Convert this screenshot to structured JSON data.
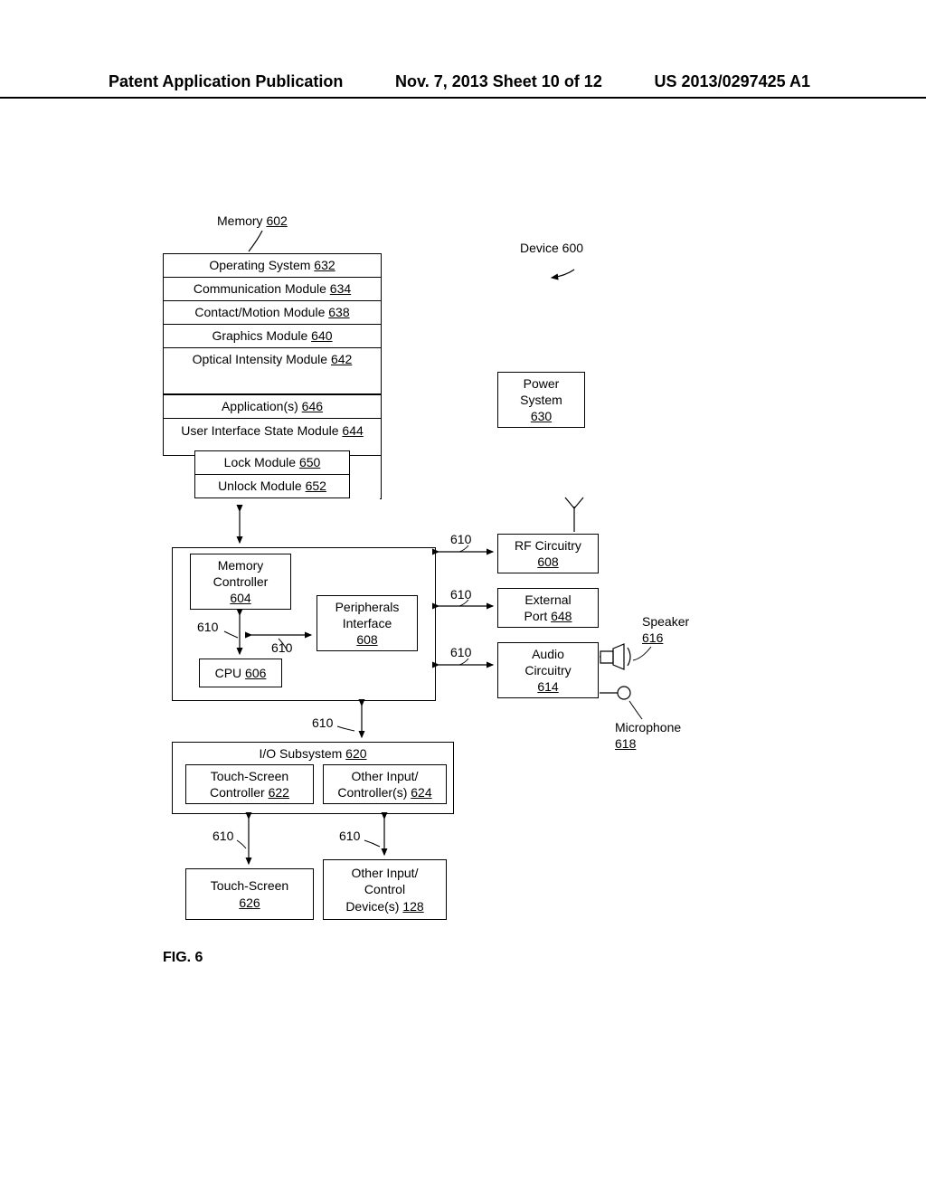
{
  "header": {
    "left": "Patent Application Publication",
    "center": "Nov. 7, 2013  Sheet 10 of 12",
    "right": "US 2013/0297425 A1"
  },
  "diagram": {
    "memory_label": "Memory",
    "memory_ref": "602",
    "device_label": "Device 600",
    "os": "Operating System",
    "os_ref": "632",
    "comm": "Communication Module",
    "comm_ref": "634",
    "contact": "Contact/Motion Module",
    "contact_ref": "638",
    "graphics": "Graphics Module",
    "graphics_ref": "640",
    "optical": "Optical Intensity Module",
    "optical_ref": "642",
    "apps": "Application(s)",
    "apps_ref": "646",
    "uistate": "User Interface State Module",
    "uistate_ref": "644",
    "lock": "Lock Module",
    "lock_ref": "650",
    "unlock": "Unlock Module",
    "unlock_ref": "652",
    "power": "Power",
    "power2": "System",
    "power_ref": "630",
    "memctrl": "Memory",
    "memctrl2": "Controller",
    "memctrl_ref": "604",
    "periph": "Peripherals",
    "periph2": "Interface",
    "periph_ref": "608",
    "rf": "RF Circuitry",
    "rf_ref": "608",
    "extport": "External",
    "extport2": "Port",
    "extport_ref": "648",
    "cpu": "CPU",
    "cpu_ref": "606",
    "audio": "Audio",
    "audio2": "Circuitry",
    "audio_ref": "614",
    "speaker": "Speaker",
    "speaker_ref": "616",
    "mic": "Microphone",
    "mic_ref": "618",
    "io": "I/O Subsystem",
    "io_ref": "620",
    "tsctrl": "Touch-Screen",
    "tsctrl2": "Controller",
    "tsctrl_ref": "622",
    "otherctrl": "Other Input/",
    "otherctrl2": "Controller(s)",
    "otherctrl_ref": "624",
    "ts": "Touch-Screen",
    "ts_ref": "626",
    "otherdev": "Other Input/",
    "otherdev2": "Control",
    "otherdev3": "Device(s)",
    "otherdev_ref": "128",
    "sig": "610",
    "fig": "FIG. 6"
  }
}
